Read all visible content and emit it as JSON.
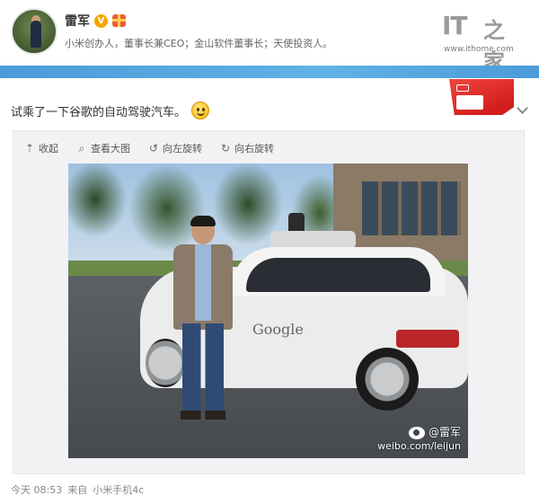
{
  "header": {
    "name": "雷军",
    "verified_badge": "V",
    "bio": "小米创办人，董事长兼CEO；金山软件董事长；天使投资人。"
  },
  "logo": {
    "brand": "IT",
    "brand_cn": "之家",
    "url": "www.ithome.com"
  },
  "post": {
    "text": "试乘了一下谷歌的自动驾驶汽车。",
    "emoji": "smile-icon"
  },
  "toolbar": {
    "collapse": "收起",
    "view_large": "查看大图",
    "rotate_left": "向左旋转",
    "rotate_right": "向右旋转"
  },
  "photo": {
    "car_brand": "Google",
    "watermark_name": "@雷军",
    "watermark_url": "weibo.com/leijun"
  },
  "footer": {
    "time": "今天 08:53",
    "source_prefix": "来自",
    "source": "小米手机4c"
  },
  "colors": {
    "accent_bar": "#4a9bd8",
    "verified": "#f7a600"
  }
}
